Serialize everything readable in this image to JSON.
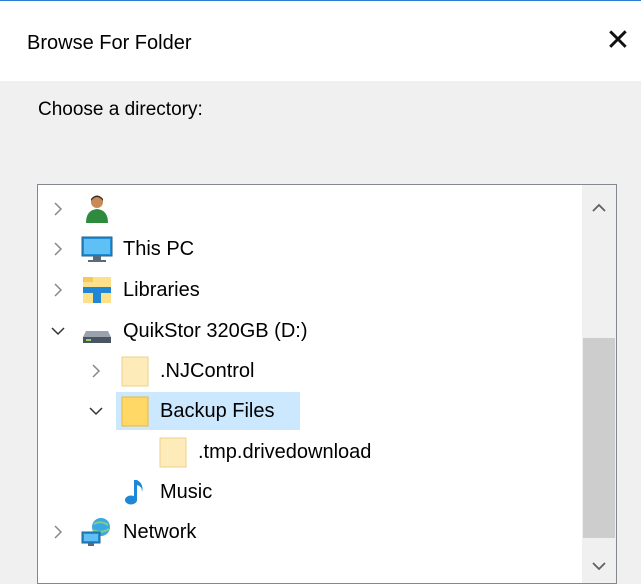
{
  "window": {
    "title": "Browse For Folder",
    "close_glyph": "✕",
    "accent_color": "#2b7cd3"
  },
  "prompt": "Choose a directory:",
  "tree": {
    "selection_color": "#cce8ff",
    "items": [
      {
        "label": "",
        "icon": "user-icon",
        "expander": "collapsed"
      },
      {
        "label": "This PC",
        "icon": "computer-icon",
        "expander": "collapsed"
      },
      {
        "label": "Libraries",
        "icon": "libraries-icon",
        "expander": "collapsed"
      },
      {
        "label": "QuikStor 320GB (D:)",
        "icon": "drive-icon",
        "expander": "expanded"
      },
      {
        "label": ".NJControl",
        "icon": "folder-icon",
        "expander": "collapsed"
      },
      {
        "label": "Backup Files",
        "icon": "folder-icon",
        "expander": "expanded",
        "selected": true
      },
      {
        "label": ".tmp.drivedownload",
        "icon": "folder-icon",
        "expander": "none"
      },
      {
        "label": "Music",
        "icon": "music-icon",
        "expander": "none"
      },
      {
        "label": "Network",
        "icon": "network-icon",
        "expander": "collapsed"
      }
    ]
  }
}
